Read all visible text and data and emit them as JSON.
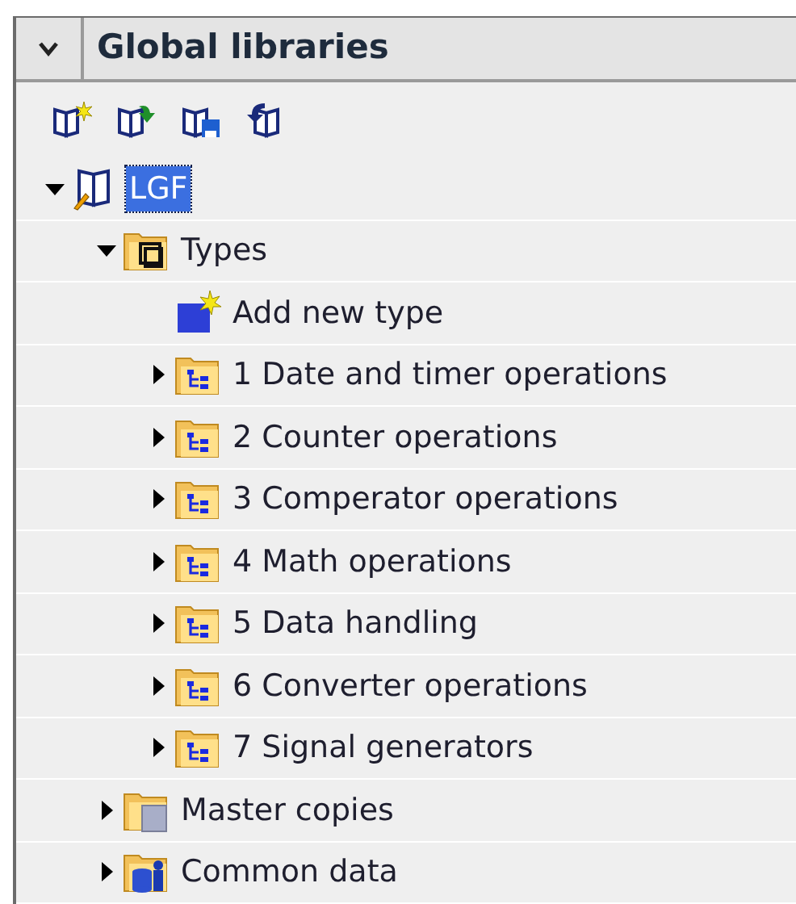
{
  "panel": {
    "title": "Global libraries",
    "collapsed": false
  },
  "toolbar": [
    {
      "kind": "new-library"
    },
    {
      "kind": "open-library"
    },
    {
      "kind": "save-library"
    },
    {
      "kind": "close-library"
    }
  ],
  "tree": [
    {
      "kind": "library",
      "label": "LGF",
      "expanded": true,
      "selected": true,
      "children": [
        {
          "kind": "types",
          "label": "Types",
          "expanded": true,
          "selected": false,
          "children": [
            {
              "kind": "add",
              "label": "Add new type",
              "selected": false
            },
            {
              "kind": "type-folder",
              "label": "1 Date and timer operations",
              "expanded": false,
              "selected": false
            },
            {
              "kind": "type-folder",
              "label": "2 Counter operations",
              "expanded": false,
              "selected": false
            },
            {
              "kind": "type-folder",
              "label": "3 Comperator operations",
              "expanded": false,
              "selected": false
            },
            {
              "kind": "type-folder",
              "label": "4 Math operations",
              "expanded": false,
              "selected": false
            },
            {
              "kind": "type-folder",
              "label": "5 Data handling",
              "expanded": false,
              "selected": false
            },
            {
              "kind": "type-folder",
              "label": "6 Converter operations",
              "expanded": false,
              "selected": false
            },
            {
              "kind": "type-folder",
              "label": "7 Signal generators",
              "expanded": false,
              "selected": false
            }
          ]
        },
        {
          "kind": "master-copies",
          "label": "Master copies",
          "expanded": false,
          "selected": false
        },
        {
          "kind": "common-data",
          "label": "Common data",
          "expanded": false,
          "selected": false
        }
      ]
    }
  ]
}
